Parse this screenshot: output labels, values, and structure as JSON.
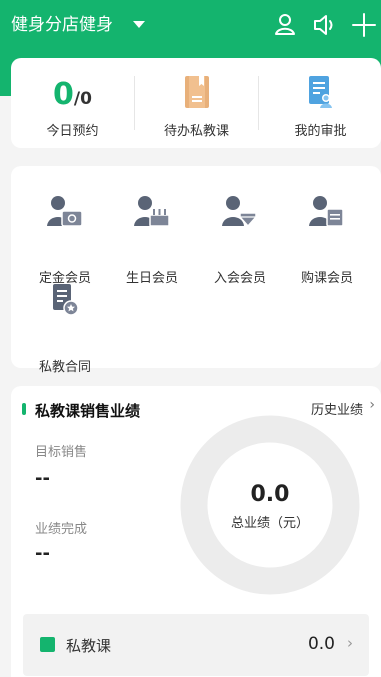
{
  "header": {
    "store_name": "健身分店健身",
    "icons": [
      "person-icon",
      "speaker-icon",
      "plus-icon"
    ]
  },
  "stats": [
    {
      "label": "今日预约",
      "value": "0",
      "total": "/0"
    },
    {
      "label": "待办私教课",
      "icon": "book-icon"
    },
    {
      "label": "我的审批",
      "icon": "approval-icon"
    }
  ],
  "members": [
    {
      "label": "定金会员",
      "icon": "deposit-member-icon"
    },
    {
      "label": "生日会员",
      "icon": "birthday-member-icon"
    },
    {
      "label": "入会会员",
      "icon": "join-member-icon"
    },
    {
      "label": "购课会员",
      "icon": "purchase-member-icon"
    },
    {
      "label": "私教合同",
      "icon": "contract-icon"
    }
  ],
  "performance": {
    "title": "私教课销售业绩",
    "history_link": "历史业绩",
    "target_label": "目标销售",
    "target_value": "--",
    "completion_label": "业绩完成",
    "completion_value": "--",
    "total_value": "0.0",
    "total_label": "总业绩（元）",
    "category": {
      "label": "私教课",
      "value": "0.0"
    }
  },
  "colors": {
    "brand": "#14b46e",
    "donut_track": "#ececec"
  }
}
